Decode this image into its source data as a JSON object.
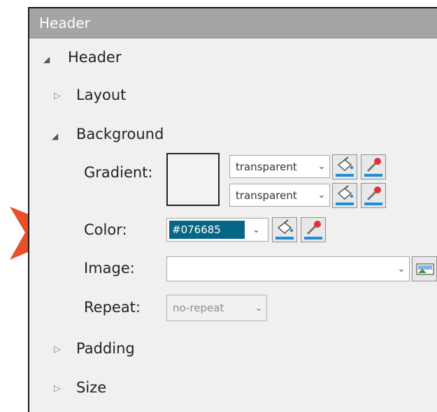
{
  "panel": {
    "title": "Header",
    "root_label": "Header",
    "sections": {
      "layout": "Layout",
      "background": "Background",
      "padding": "Padding",
      "size": "Size"
    }
  },
  "background": {
    "gradient_label": "Gradient:",
    "gradient_start": "transparent",
    "gradient_end": "transparent",
    "color_label": "Color:",
    "color_value": "#076685",
    "image_label": "Image:",
    "image_value": "",
    "repeat_label": "Repeat:",
    "repeat_value": "no-repeat"
  },
  "colors": {
    "selected_color": "#076685",
    "callout_arrow": "#e8502a",
    "titlebar": "#a5a5a5"
  },
  "icons": {
    "fill": "paint-bucket-icon",
    "picker": "eyedropper-icon",
    "image": "image-browse-icon",
    "expanded": "triangle-down-icon",
    "collapsed": "triangle-right-icon",
    "dropdown": "chevron-down-icon"
  }
}
